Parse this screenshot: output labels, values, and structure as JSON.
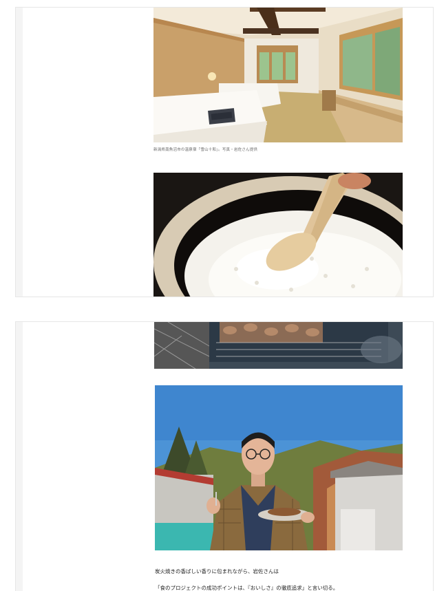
{
  "panel1": {
    "caption": "新潟県南魚沼市の温泉宿「雪山十和」。写真・岩佐さん提供",
    "room_photo_icon": "hotel-room-photo",
    "rice_photo_icon": "rice-pot-photo"
  },
  "panel2": {
    "grill_photo_icon": "charcoal-grill-photo",
    "portrait_photo_icon": "man-with-plate-photo",
    "paragraph": [
      "炭火焼きの香ばしい香りに包まれながら、岩佐さんは",
      "「食のプロジェクトの成功ポイントは、『おいしさ』の徹底追求」と言い切る。"
    ]
  },
  "colors": {
    "background": "#ffffff",
    "border": "#e6e6e6",
    "caption_text": "#666666",
    "body_text": "#222222"
  }
}
